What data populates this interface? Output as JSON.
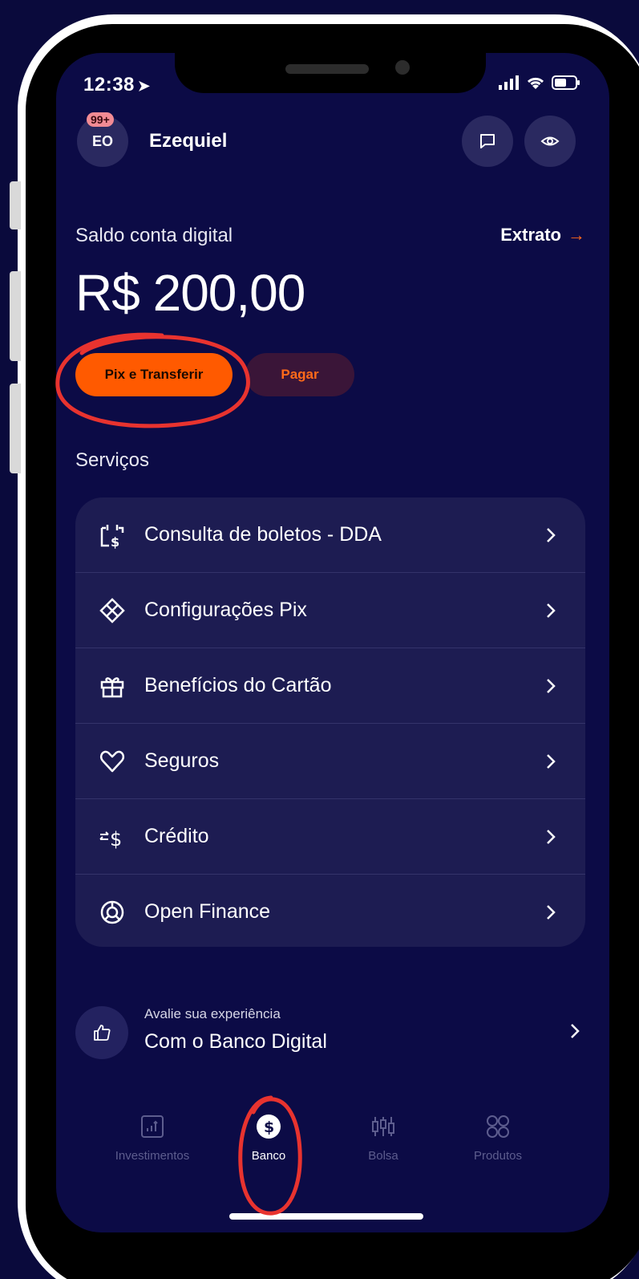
{
  "status": {
    "time": "12:38"
  },
  "header": {
    "badge": "99+",
    "avatar_initials": "EO",
    "user_name": "Ezequiel"
  },
  "balance": {
    "label": "Saldo conta digital",
    "value": "R$ 200,00",
    "extrato_label": "Extrato"
  },
  "actions": {
    "pix_label": "Pix e Transferir",
    "pagar_label": "Pagar"
  },
  "services": {
    "title": "Serviços",
    "items": [
      {
        "label": "Consulta de boletos - DDA",
        "icon": "calendar-dollar-icon"
      },
      {
        "label": "Configurações Pix",
        "icon": "pix-icon"
      },
      {
        "label": "Benefícios do Cartão",
        "icon": "gift-icon"
      },
      {
        "label": "Seguros",
        "icon": "heart-icon"
      },
      {
        "label": "Crédito",
        "icon": "credit-exchange-icon"
      },
      {
        "label": "Open Finance",
        "icon": "open-finance-icon"
      }
    ]
  },
  "feedback": {
    "subtitle": "Avalie sua experiência",
    "title": "Com o Banco Digital"
  },
  "tabbar": {
    "tabs": [
      {
        "label": "Investimentos",
        "icon": "chart-icon",
        "active": false
      },
      {
        "label": "Banco",
        "icon": "dollar-coin-icon",
        "active": true
      },
      {
        "label": "Bolsa",
        "icon": "candlestick-icon",
        "active": false
      },
      {
        "label": "Produtos",
        "icon": "grid-icon",
        "active": false
      }
    ]
  },
  "colors": {
    "background": "#0c0b46",
    "accent": "#ff5a00",
    "annotation": "#e8332f"
  }
}
